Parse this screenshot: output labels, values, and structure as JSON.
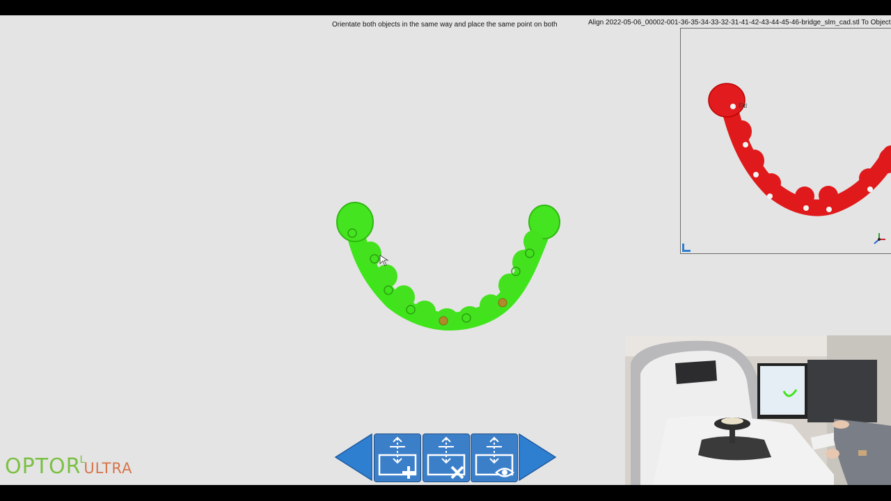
{
  "instruction": "Orientate both objects in the same way and place the same point on both",
  "align_title": "Align 2022-05-06_00002-001-36-35-34-33-32-31-41-42-43-44-45-46-bridge_slm_cad.stl To Object",
  "inset": {
    "point_label": "Fitl",
    "model_color": "#e0191b",
    "corner_icon": "view-corner-icon",
    "axis_icon": "axis-triad-icon"
  },
  "main_model": {
    "color": "#3fe41b",
    "selected_point_color": "#b08a2a"
  },
  "toolbar": {
    "prev_icon": "arrow-left-icon",
    "add_point_icon": "add-point-icon",
    "remove_point_icon": "remove-point-icon",
    "view_point_icon": "view-point-icon",
    "next_icon": "arrow-right-icon",
    "button_color": "#3c7fc9"
  },
  "logo": {
    "main": "OPTOR",
    "superscript": "L",
    "suffix": "ULTRA",
    "main_color": "#7bc043",
    "suffix_color": "#d6744a"
  }
}
